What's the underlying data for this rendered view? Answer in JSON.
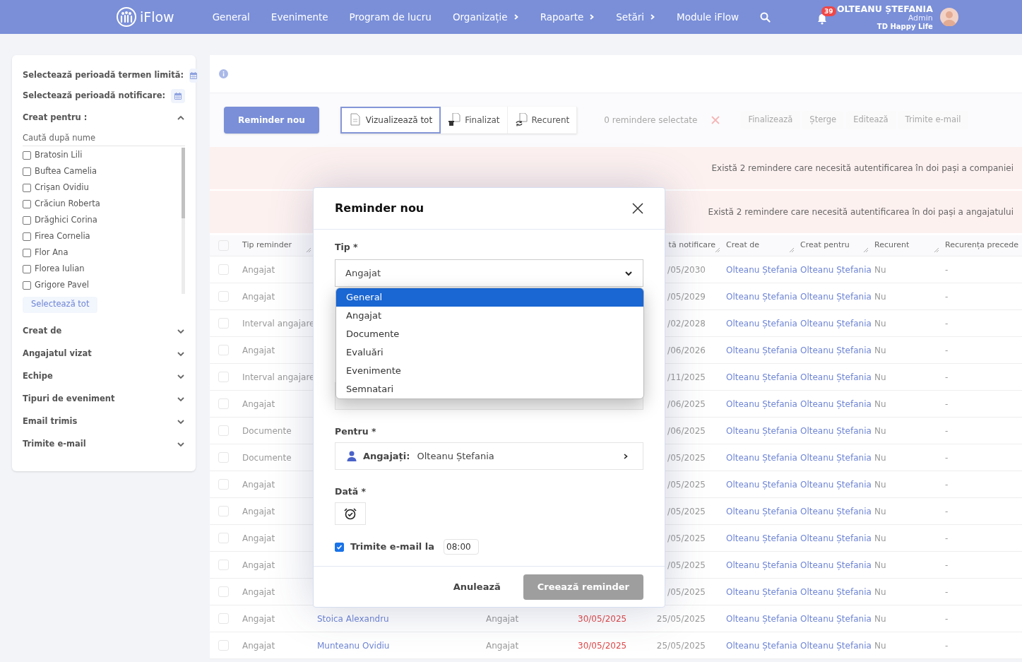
{
  "navbar": {
    "logo": "iFlow",
    "menu": [
      {
        "label": "General",
        "has_submenu": false
      },
      {
        "label": "Evenimente",
        "has_submenu": false
      },
      {
        "label": "Program de lucru",
        "has_submenu": false
      },
      {
        "label": "Organizație",
        "has_submenu": true
      },
      {
        "label": "Rapoarte",
        "has_submenu": true
      },
      {
        "label": "Setări",
        "has_submenu": true
      },
      {
        "label": "Module iFlow",
        "has_submenu": false
      }
    ],
    "notifications": "39",
    "user": {
      "name": "OLTEANU ȘTEFANIA",
      "role": "Admin",
      "company": "TD Happy Life"
    }
  },
  "filters": {
    "deadline_period": "Selectează perioadă termen limită:",
    "notification_period": "Selectează perioadă notificare:",
    "created_for": {
      "title": "Creat pentru :",
      "expanded": true,
      "search_placeholder": "Caută după nume",
      "people": [
        {
          "name": "Bratosin Lili",
          "checked": false
        },
        {
          "name": "Buftea Camelia",
          "checked": false
        },
        {
          "name": "Crișan Ovidiu",
          "checked": false
        },
        {
          "name": "Crăciun Roberta",
          "checked": false
        },
        {
          "name": "Drăghici Corina",
          "checked": false
        },
        {
          "name": "Firea Cornelia",
          "checked": false
        },
        {
          "name": "Flor Ana",
          "checked": false
        },
        {
          "name": "Florea Iulian",
          "checked": false
        },
        {
          "name": "Grigore Pavel",
          "checked": false
        }
      ],
      "select_all": "Selectează tot"
    },
    "sections": [
      {
        "title": "Creat de",
        "expanded": false
      },
      {
        "title": "Angajatul vizat",
        "expanded": false
      },
      {
        "title": "Echipe",
        "expanded": false
      },
      {
        "title": "Tipuri de eveniment",
        "expanded": false
      },
      {
        "title": "Email trimis",
        "expanded": false
      },
      {
        "title": "Trimite e-mail",
        "expanded": false
      }
    ]
  },
  "toolbar": {
    "new_button": "Reminder nou",
    "views": [
      {
        "label": "Vizualizează tot",
        "selected": true,
        "kind": "all"
      },
      {
        "label": "Finalizat",
        "selected": false,
        "kind": "done"
      },
      {
        "label": "Recurent",
        "selected": false,
        "kind": "recurring"
      }
    ],
    "selected_count": "0 remindere selectate",
    "actions": [
      {
        "label": "Finalizează",
        "disabled": true
      },
      {
        "label": "Șterge",
        "disabled": true
      },
      {
        "label": "Editează",
        "disabled": true
      },
      {
        "label": "Trimite e-mail",
        "disabled": true
      }
    ]
  },
  "alerts": [
    "Există 2 remindere care necesită autentificarea în doi pași a companiei",
    "Există 2 remindere care necesită autentificarea în doi pași a angajatului"
  ],
  "table": {
    "all_selected": false,
    "columns": {
      "tip": "Tip reminder",
      "notificare": "tă notificare",
      "creat_de": "Creat de",
      "creat_pentru": "Creat pentru",
      "recurent": "Recurent",
      "recurenta": "Recurența precede"
    },
    "rows": [
      {
        "selected": false,
        "tip": "Angajat",
        "notificare": "/05/2030",
        "creat_de": "Olteanu Ștefania",
        "creat_pentru": "Olteanu Ștefania",
        "recurent": "Nu",
        "recurenta": "-"
      },
      {
        "selected": false,
        "tip": "Angajat",
        "notificare": "/05/2029",
        "creat_de": "Olteanu Ștefania",
        "creat_pentru": "Olteanu Ștefania",
        "recurent": "Nu",
        "recurenta": "-"
      },
      {
        "selected": false,
        "tip": "Interval angajare",
        "notificare": "/02/2028",
        "creat_de": "Olteanu Ștefania",
        "creat_pentru": "Olteanu Ștefania",
        "recurent": "Nu",
        "recurenta": "-"
      },
      {
        "selected": false,
        "tip": "Angajat",
        "notificare": "/06/2026",
        "creat_de": "Olteanu Ștefania",
        "creat_pentru": "Olteanu Ștefania",
        "recurent": "Nu",
        "recurenta": "-"
      },
      {
        "selected": false,
        "tip": "Interval angajare",
        "notificare": "/11/2025",
        "creat_de": "Olteanu Ștefania",
        "creat_pentru": "Olteanu Ștefania",
        "recurent": "Nu",
        "recurenta": "-"
      },
      {
        "selected": false,
        "tip": "Angajat",
        "notificare": "/06/2025",
        "creat_de": "Olteanu Ștefania",
        "creat_pentru": "Olteanu Ștefania",
        "recurent": "Nu",
        "recurenta": "-"
      },
      {
        "selected": false,
        "tip": "Documente",
        "notificare": "/06/2025",
        "creat_de": "Olteanu Ștefania",
        "creat_pentru": "Olteanu Ștefania",
        "recurent": "Nu",
        "recurenta": "-"
      },
      {
        "selected": false,
        "tip": "Documente",
        "notificare": "/05/2025",
        "creat_de": "Olteanu Ștefania",
        "creat_pentru": "Olteanu Ștefania",
        "recurent": "Nu",
        "recurenta": "-"
      },
      {
        "selected": false,
        "tip": "Angajat",
        "notificare": "/05/2025",
        "creat_de": "Olteanu Ștefania",
        "creat_pentru": "Olteanu Ștefania",
        "recurent": "Nu",
        "recurenta": "-"
      },
      {
        "selected": false,
        "tip": "Angajat",
        "notificare": "/05/2025",
        "creat_de": "Olteanu Ștefania",
        "creat_pentru": "Olteanu Ștefania",
        "recurent": "Nu",
        "recurenta": "-"
      },
      {
        "selected": false,
        "tip": "Angajat",
        "notificare": "/05/2025",
        "creat_de": "Olteanu Ștefania",
        "creat_pentru": "Olteanu Ștefania",
        "recurent": "Nu",
        "recurenta": "-"
      },
      {
        "selected": false,
        "tip": "Angajat",
        "notificare": "/05/2025",
        "creat_de": "Olteanu Ștefania",
        "creat_pentru": "Olteanu Ștefania",
        "recurent": "Nu",
        "recurenta": "-"
      },
      {
        "selected": false,
        "tip": "Angajat",
        "notificare": "/05/2025",
        "creat_de": "Olteanu Ștefania",
        "creat_pentru": "Olteanu Ștefania",
        "recurent": "Nu",
        "recurenta": "-"
      },
      {
        "selected": false,
        "tip": "Angajat",
        "column_2": "Stoica Alexandru",
        "column_3": "Angajat",
        "column_4": "30/05/2025",
        "notificare": "25/05/2025",
        "creat_de": "Olteanu Ștefania",
        "creat_pentru": "Olteanu Ștefania",
        "recurent": "Nu",
        "recurenta": "-"
      },
      {
        "selected": false,
        "tip": "Angajat",
        "column_2": "Munteanu Ovidiu",
        "column_3": "Angajat",
        "column_4": "30/05/2025",
        "notificare": "25/05/2025",
        "creat_de": "Olteanu Ștefania",
        "creat_pentru": "Olteanu Ștefania",
        "recurent": "Nu",
        "recurenta": "-"
      }
    ]
  },
  "modal": {
    "title": "Reminder nou",
    "tip_label": "Tip *",
    "tip_value": "Angajat",
    "tip_options": [
      {
        "label": "General",
        "selected": true
      },
      {
        "label": "Angajat",
        "selected": false
      },
      {
        "label": "Documente",
        "selected": false
      },
      {
        "label": "Evaluări",
        "selected": false
      },
      {
        "label": "Evenimente",
        "selected": false
      },
      {
        "label": "Semnatari",
        "selected": false
      }
    ],
    "pentru_label": "Pentru *",
    "pentru_prefix": "Angajați:",
    "pentru_value": "Olteanu Ștefania",
    "data_label": "Dată *",
    "send_email": {
      "label": "Trimite e-mail la",
      "checked": true,
      "time": "08:00"
    },
    "cancel": "Anulează",
    "create": {
      "label": "Creează reminder",
      "disabled": true
    }
  }
}
